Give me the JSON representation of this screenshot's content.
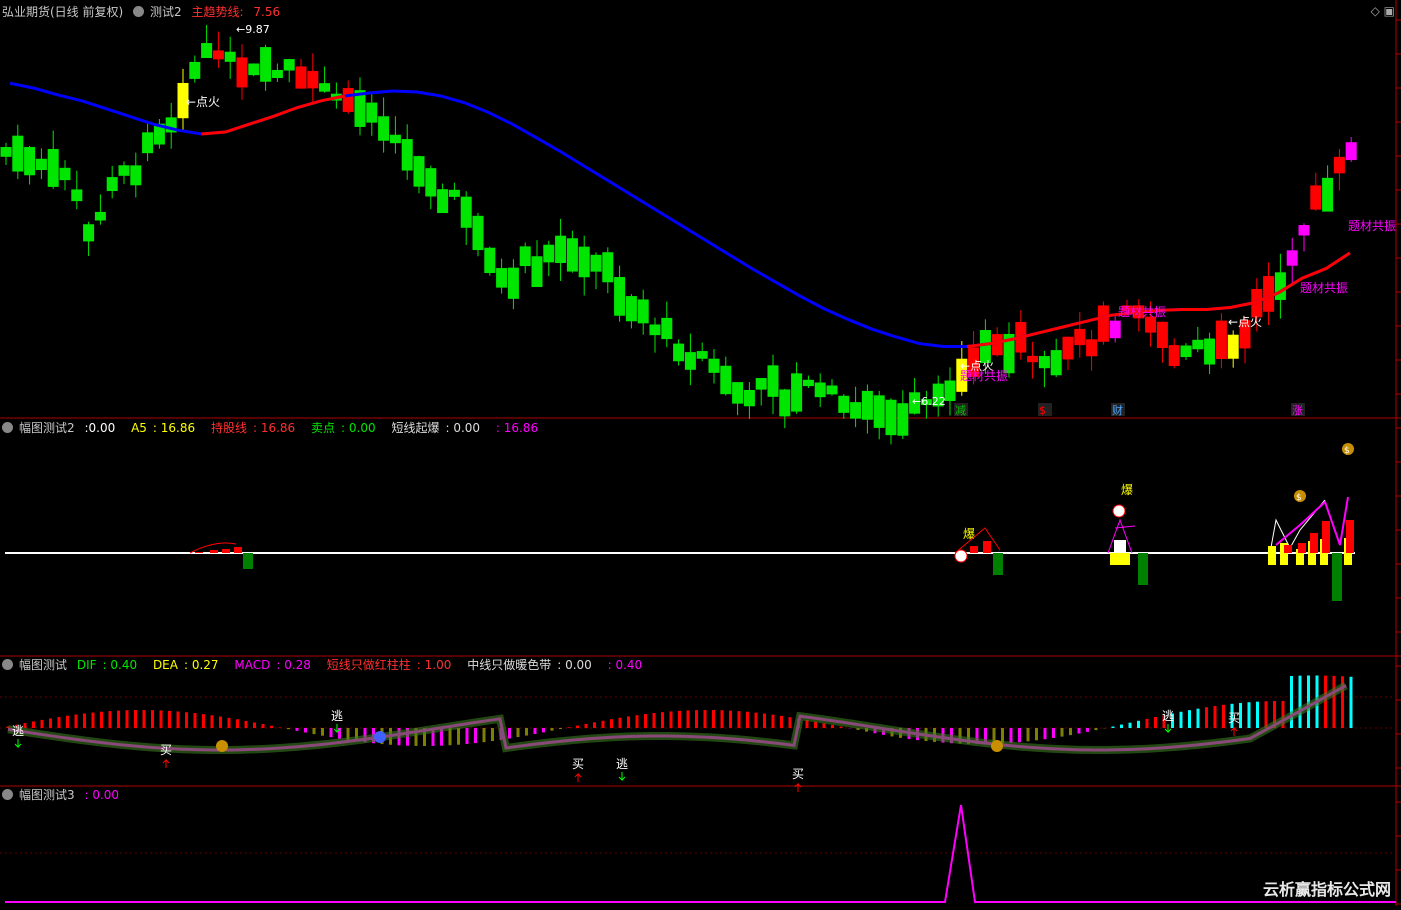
{
  "colors": {
    "up": "#ff0000",
    "down": "#00e600",
    "blue": "#0000ff",
    "magenta": "#ff00ff",
    "yellow": "#ffff00",
    "cyan": "#00ffff",
    "white": "#ffffff",
    "sep": "#b00000"
  },
  "panel1": {
    "title": "弘业期货(日线 前复权)",
    "indicator": "测试2",
    "line_label": "主趋势线",
    "line_value": "7.56",
    "high_label": "9.87",
    "low_label": "6.22",
    "ann_fire": "点火",
    "ann_theme": "题材共振",
    "badges": [
      "减",
      "$",
      "财",
      "涨"
    ]
  },
  "panel2": {
    "name": "幅图测试2",
    "values": [
      {
        "label": "",
        "value": "0.00"
      },
      {
        "label": "A5",
        "value": "16.86"
      },
      {
        "label": "持股线",
        "value": "16.86"
      },
      {
        "label": "卖点",
        "value": "0.00"
      },
      {
        "label": "短线起爆",
        "value": "0.00"
      },
      {
        "label": "",
        "value": "16.86"
      }
    ],
    "burst": "爆"
  },
  "panel3": {
    "name": "幅图测试",
    "values": [
      {
        "label": "DIF",
        "value": "0.40"
      },
      {
        "label": "DEA",
        "value": "0.27"
      },
      {
        "label": "MACD",
        "value": "0.28"
      },
      {
        "label": "短线只做红柱柱",
        "value": "1.00"
      },
      {
        "label": "中线只做暖色带",
        "value": "0.00"
      },
      {
        "label": "",
        "value": "0.40"
      }
    ],
    "buy": "买",
    "escape": "逃"
  },
  "panel4": {
    "name": "幅图测试3",
    "value": "0.00"
  },
  "watermark": "云析赢指标公式网",
  "chart_data": {
    "type": "line",
    "series": [
      {
        "name": "主趋势线",
        "values": [
          9.3,
          9.25,
          9.18,
          9.12,
          9.04,
          8.96,
          8.88,
          8.82,
          8.78,
          8.8,
          8.88,
          8.96,
          9.05,
          9.12,
          9.17,
          9.2,
          9.22,
          9.21,
          9.17,
          9.1,
          9.0,
          8.88,
          8.74,
          8.6,
          8.45,
          8.3,
          8.15,
          8.0,
          7.85,
          7.7,
          7.55,
          7.4,
          7.26,
          7.12,
          6.99,
          6.88,
          6.78,
          6.7,
          6.63,
          6.6,
          6.6,
          6.63,
          6.68,
          6.74,
          6.8,
          6.86,
          6.92,
          6.95,
          6.97,
          6.98,
          6.98,
          7.0,
          7.05,
          7.15,
          7.3,
          7.4,
          7.56
        ]
      }
    ],
    "ylim": [
      6.0,
      10.0
    ]
  }
}
